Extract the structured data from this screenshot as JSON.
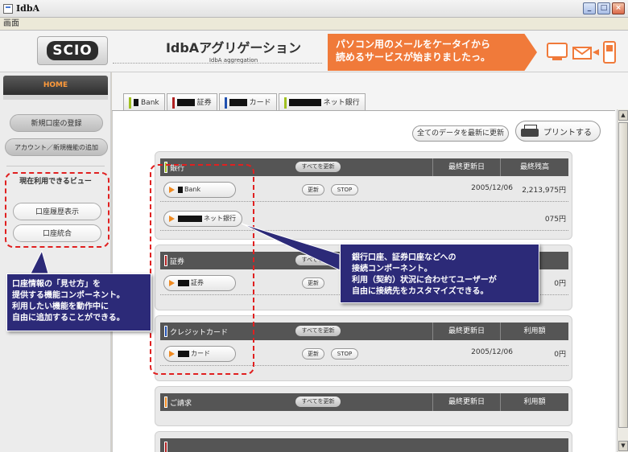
{
  "window": {
    "title": "IdbA",
    "menu": "画面",
    "buttons": {
      "minimize": "_",
      "maximize": "□",
      "close": "×"
    }
  },
  "header": {
    "logo": "SCIO",
    "title": "IdbAアグリゲーション",
    "subtitle": "IdbA aggregation",
    "promo_line1": "パソコン用のメールをケータイから",
    "promo_line2": "読めるサービスが始まりましたっ。",
    "icons": [
      "computer-icon",
      "mail-icon",
      "mobile-phone-icon"
    ]
  },
  "sidebar": {
    "home": "HOME",
    "register": "新規口座の登録",
    "account_add": "アカウント／新規機能の追加",
    "current_views_title": "現在利用できるビュー",
    "history_view": "口座履歴表示",
    "integrate": "口座統合"
  },
  "tabs": [
    {
      "suffix": "Bank",
      "color": "#a0c020"
    },
    {
      "suffix": "証券",
      "color": "#b02020"
    },
    {
      "suffix": "カード",
      "color": "#2050b0"
    },
    {
      "suffix": "ネット銀行",
      "color": "#a0c020"
    }
  ],
  "toolbar": {
    "refresh_all": "全てのデータを最新に更新",
    "print": "プリントする"
  },
  "labels": {
    "refresh_all_small": "すべてを更新",
    "last_update": "最終更新日",
    "balance": "最終残高",
    "usage": "利用額",
    "update": "更新",
    "stop": "STOP"
  },
  "panels": {
    "bank": {
      "title": "銀行",
      "color": "#a0c020",
      "rows": [
        {
          "name": "Bank",
          "date": "2005/12/06",
          "amount": "2,213,975円"
        },
        {
          "name": "ネット銀行",
          "amount": "075円"
        }
      ]
    },
    "securities": {
      "title": "証券",
      "color": "#b02020",
      "rows": [
        {
          "name": "証券",
          "amount": "0円"
        }
      ]
    },
    "credit": {
      "title": "クレジットカード",
      "color": "#2050b0",
      "rows": [
        {
          "name": "カード",
          "date": "2005/12/06",
          "amount": "0円"
        }
      ]
    },
    "billing": {
      "title": "ご請求",
      "color": "#f08a20"
    }
  },
  "annotations": {
    "left": [
      "口座情報の「見せ方」を",
      "提供する機能コンポーネント。",
      "利用したい機能を動作中に",
      "自由に追加することができる。"
    ],
    "right": [
      "銀行口座、証券口座などへの",
      "接続コンポーネント。",
      "利用（契約）状況に合わせてユーザーが",
      "自由に接続先をカスタマイズできる。"
    ]
  }
}
